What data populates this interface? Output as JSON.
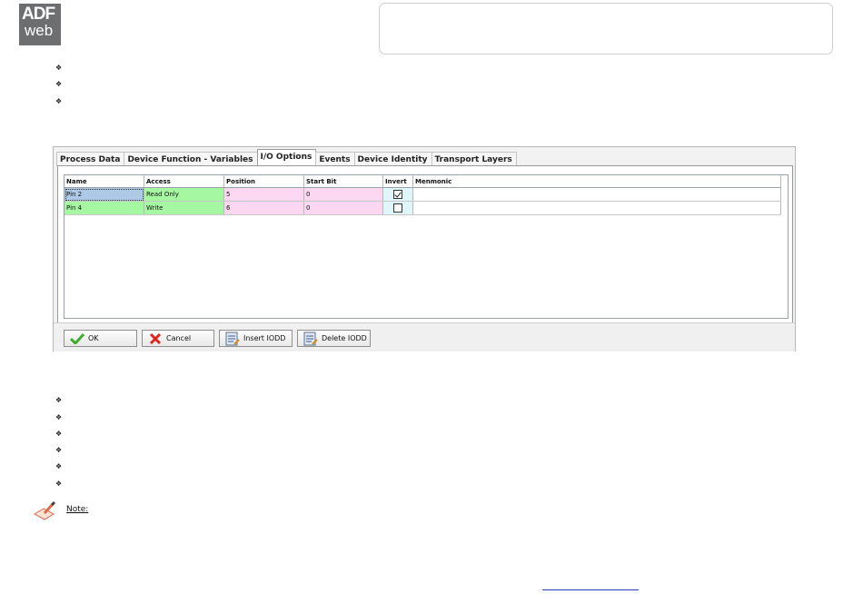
{
  "brand": {
    "logo_top": "ADF",
    "logo_bottom": "web"
  },
  "header": {
    "text": ""
  },
  "tabs": [
    {
      "label": "Process Data"
    },
    {
      "label": "Device Function - Variables"
    },
    {
      "label": "I/O Options"
    },
    {
      "label": "Events"
    },
    {
      "label": "Device Identity"
    },
    {
      "label": "Transport Layers"
    }
  ],
  "active_tab": "I/O Options",
  "table": {
    "columns": [
      "Name",
      "Access",
      "Position",
      "Start Bit",
      "Invert",
      "Menmonic"
    ],
    "rows": [
      {
        "name": "Pin 2",
        "access": "Read Only",
        "position": "5",
        "start_bit": "0",
        "invert": true,
        "mnemonic": ""
      },
      {
        "name": "Pin 4",
        "access": "Write",
        "position": "6",
        "start_bit": "0",
        "invert": false,
        "mnemonic": ""
      }
    ]
  },
  "buttons": {
    "ok": "OK",
    "cancel": "Cancel",
    "insert": "Insert IODD",
    "delete": "Delete IODD"
  },
  "note": {
    "label": "Note:"
  },
  "footer": {
    "link_text": ""
  },
  "colors": {
    "name_access_cell": "#a6f7a2",
    "position_bit_cell": "#fcd7f2",
    "invert_cell": "#dff6fa",
    "selection": "#aec9e6",
    "link": "#2a36c8"
  }
}
